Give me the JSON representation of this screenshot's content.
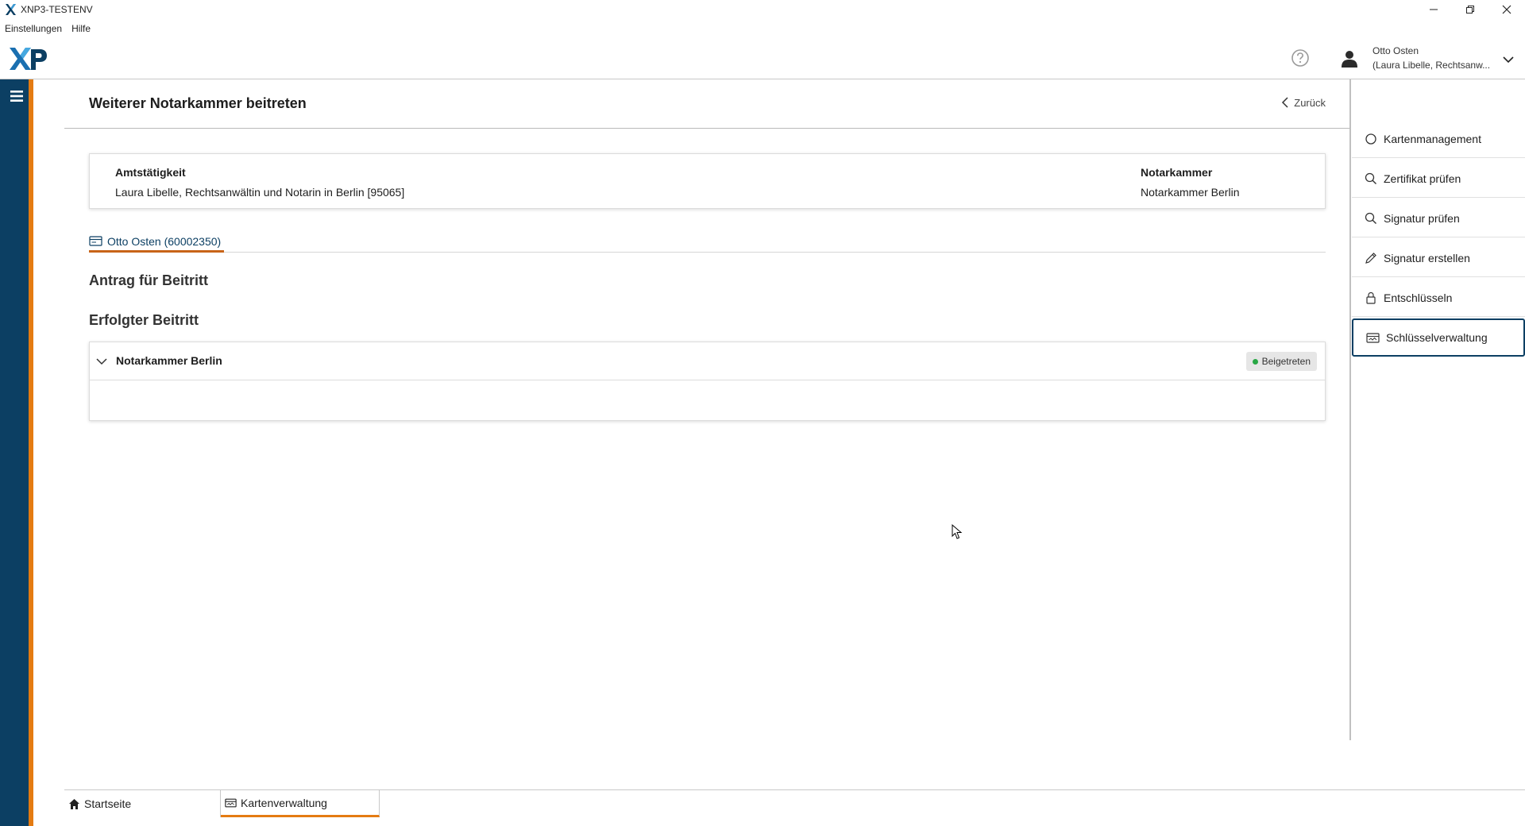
{
  "window": {
    "title": "XNP3-TESTENV"
  },
  "menu": {
    "items": [
      "Einstellungen",
      "Hilfe"
    ]
  },
  "header": {
    "logo_text": "XP",
    "user_name": "Otto Osten",
    "user_role": "(Laura Libelle, Rechtsanw..."
  },
  "page": {
    "title": "Weiterer Notarkammer beitreten",
    "back_label": "Zurück"
  },
  "info_card": {
    "amt_label": "Amtstätigkeit",
    "amt_value": "Laura Libelle, Rechtsanwältin und Notarin in Berlin [95065]",
    "kammer_label": "Notarkammer",
    "kammer_value": "Notarkammer Berlin"
  },
  "tab": {
    "label": "Otto Osten (60002350)"
  },
  "sections": {
    "antrag": "Antrag für Beitritt",
    "erfolgt": "Erfolgter Beitritt"
  },
  "accordion": {
    "title": "Notarkammer Berlin",
    "status": "Beigetreten"
  },
  "right_panel": {
    "items": [
      {
        "label": "Kartenmanagement",
        "icon": "circle-icon"
      },
      {
        "label": "Zertifikat prüfen",
        "icon": "search-icon"
      },
      {
        "label": "Signatur prüfen",
        "icon": "search-icon"
      },
      {
        "label": "Signatur erstellen",
        "icon": "pen-icon"
      },
      {
        "label": "Entschlüsseln",
        "icon": "lock-icon"
      },
      {
        "label": "Schlüsselverwaltung",
        "icon": "card-icon"
      }
    ],
    "active_index": 5
  },
  "bottom_tabs": {
    "start": "Startseite",
    "karten": "Kartenverwaltung"
  },
  "colors": {
    "brand_dark": "#0c3f63",
    "accent_orange": "#e47b12",
    "status_green": "#28a745"
  }
}
